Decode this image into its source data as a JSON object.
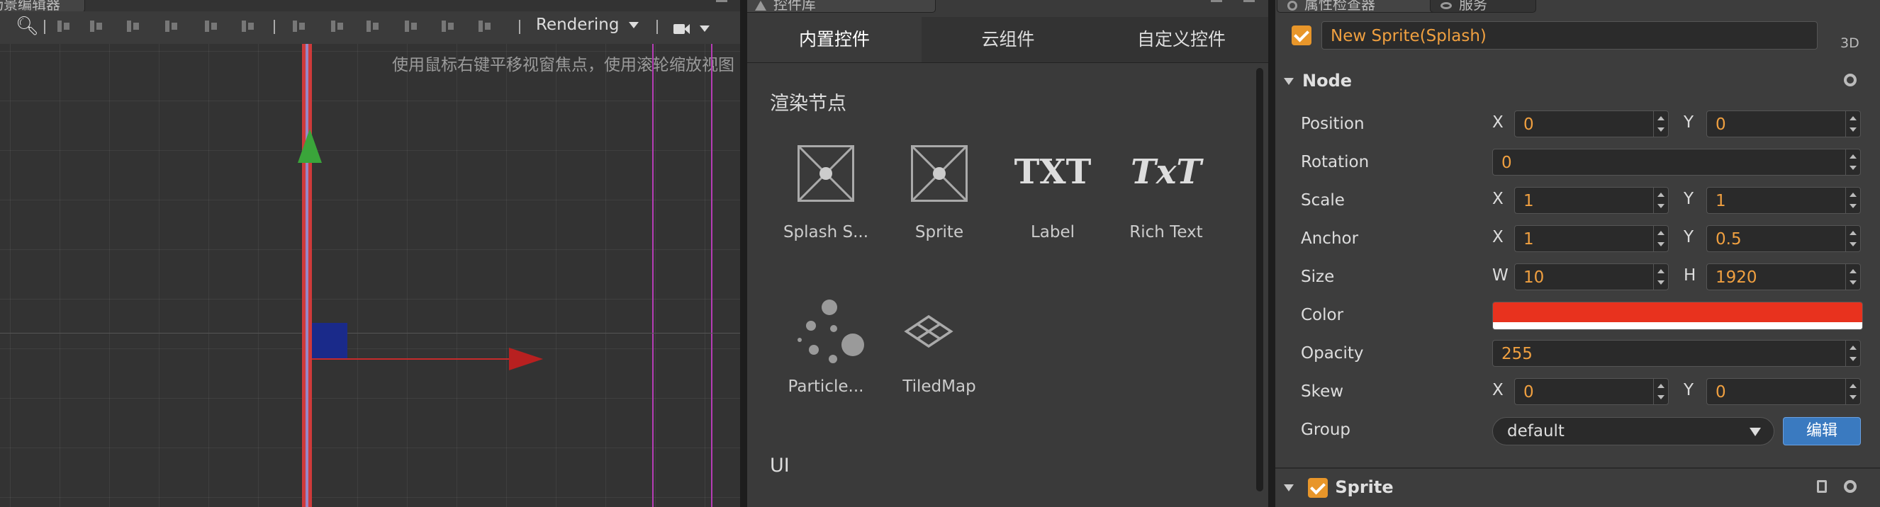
{
  "scene_editor": {
    "tab_title": "场景编辑器",
    "render_mode": "Rendering",
    "hint": "使用鼠标右键平移视窗焦点，使用滚轮缩放视图"
  },
  "control_library": {
    "tab_title": "控件库",
    "tabs": [
      {
        "label": "内置控件",
        "active": true
      },
      {
        "label": "云组件",
        "active": false
      },
      {
        "label": "自定义控件",
        "active": false
      }
    ],
    "section_render": "渲染节点",
    "render_items": [
      {
        "label": "Splash S...",
        "icon": "splash-sprite-icon"
      },
      {
        "label": "Sprite",
        "icon": "sprite-icon"
      },
      {
        "label": "Label",
        "icon": "label-icon",
        "glyph": "TXT"
      },
      {
        "label": "Rich Text",
        "icon": "rich-text-icon",
        "glyph": "TxT"
      },
      {
        "label": "Particle...",
        "icon": "particle-icon"
      },
      {
        "label": "TiledMap",
        "icon": "tiledmap-icon"
      }
    ],
    "section_ui": "UI"
  },
  "inspector": {
    "tab_title": "属性检查器",
    "tab_service": "服务",
    "node_name": "New Sprite(Splash)",
    "mode_3d": "3D",
    "node_section": "Node",
    "position": {
      "label": "Position",
      "x_label": "X",
      "x": "0",
      "y_label": "Y",
      "y": "0"
    },
    "rotation": {
      "label": "Rotation",
      "value": "0"
    },
    "scale": {
      "label": "Scale",
      "x_label": "X",
      "x": "1",
      "y_label": "Y",
      "y": "1"
    },
    "anchor": {
      "label": "Anchor",
      "x_label": "X",
      "x": "1",
      "y_label": "Y",
      "y": "0.5"
    },
    "size": {
      "label": "Size",
      "w_label": "W",
      "w": "10",
      "h_label": "H",
      "h": "1920"
    },
    "color": {
      "label": "Color",
      "value": "#e8321e"
    },
    "opacity": {
      "label": "Opacity",
      "value": "255"
    },
    "skew": {
      "label": "Skew",
      "x_label": "X",
      "x": "0",
      "y_label": "Y",
      "y": "0"
    },
    "group": {
      "label": "Group",
      "value": "default",
      "edit_label": "编辑"
    },
    "sprite_section": "Sprite"
  }
}
